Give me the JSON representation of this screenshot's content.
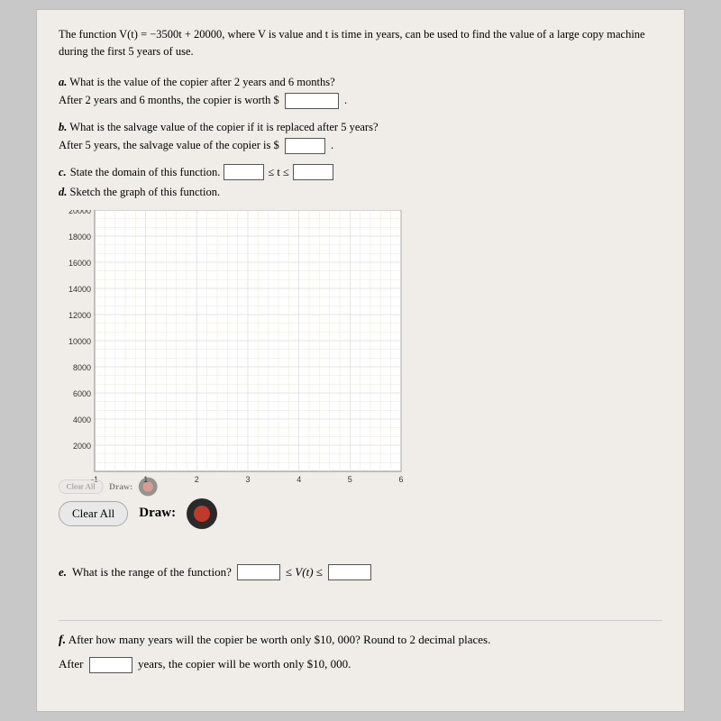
{
  "intro": {
    "text": "The function V(t) = −3500t + 20000, where V is value and t is time in years, can be used to find the value of a large copy machine during the first 5 years of use."
  },
  "questions": {
    "a_label": "a.",
    "a_text": "What is the value of the copier after 2 years and 6 months?",
    "a_fill": "After 2 years and 6 months, the copier is worth $",
    "a_input_placeholder": "",
    "b_label": "b.",
    "b_text": "What is the salvage value of the copier if it is replaced after 5 years?",
    "b_fill": "After 5 years, the salvage value of the copier is $",
    "b_input_placeholder": "",
    "c_label": "c.",
    "c_text": "State the domain of this function.",
    "c_lte": "≤ t ≤",
    "d_label": "d.",
    "d_text": "Sketch the graph of this function.",
    "e_label": "e.",
    "e_text": "What is the range of the function?",
    "e_lte1": "≤ V(t) ≤",
    "f_label": "f.",
    "f_text": "After how many years will the copier be worth only $10, 000? Round to 2 decimal places.",
    "f_fill": "After",
    "f_fill2": "years, the copier will be worth only $10, 000."
  },
  "graph": {
    "y_labels": [
      "20000",
      "18000",
      "16000",
      "14000",
      "12000",
      "10000",
      "8000",
      "6000",
      "4000",
      "2000"
    ],
    "x_labels": [
      "1",
      "2",
      "3",
      "4",
      "5",
      "6"
    ]
  },
  "toolbar": {
    "clear_all_label": "Clear All",
    "draw_label": "Draw:",
    "small_clear_label": "Clear All",
    "small_draw_label": "Draw:"
  },
  "colors": {
    "button_bg": "#e8e8e8",
    "draw_circle_bg": "#2a2a2a",
    "draw_dot_bg": "#c0392b",
    "grid_line": "#d0c8b8",
    "axis_line": "#555"
  }
}
